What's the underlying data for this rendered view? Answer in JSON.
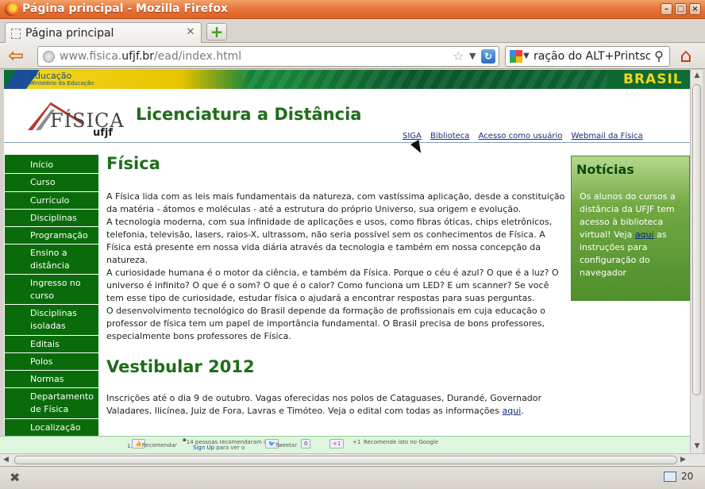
{
  "window": {
    "title": "Página principal - Mozilla Firefox"
  },
  "tab": {
    "label": "Página principal",
    "new_tab": "+"
  },
  "toolbar": {
    "url_prefix": "www.fisica.",
    "url_domain": "ufjf.br",
    "url_suffix": "/ead/index.html",
    "search_value": "ração do ALT+Printscr",
    "search_engine_icon": "google-icon"
  },
  "gov_bar": {
    "edu_label": "Educação",
    "ministry_label": "Ministério da Educação",
    "brasil_label": "BRASIL"
  },
  "header": {
    "logo_text": "FÍSICA",
    "logo_sub": "ufjf",
    "title": "Licenciatura a Distância",
    "links": [
      "SIGA",
      "Biblioteca",
      "Acesso como usuário",
      "Webmail da Física"
    ]
  },
  "sidebar": {
    "items": [
      "Início",
      "Curso",
      "Currículo",
      "Disciplinas",
      "Programação",
      "Ensino a distância",
      "Ingresso no curso",
      "Disciplinas isoladas",
      "Editais",
      "Polos",
      "Normas",
      "Departamento de Física",
      "Localização"
    ]
  },
  "main": {
    "section1_title": "Física",
    "section1_p1": "A Física lida com as leis mais fundamentais da natureza, com vastíssima aplicação, desde a constituição da matéria - átomos e moléculas - até a estrutura do próprio Universo, sua origem e evolução.",
    "section1_p2": "A tecnologia moderna, com sua infinidade de aplicações e usos, como fibras óticas, chips eletrônicos, telefonia, televisão, lasers, raios-X, ultrassom, não seria possível sem os conhecimentos de Física. A Física está presente em nossa vida diária através da tecnologia e também em nossa concepção da natureza.",
    "section1_p3": "A curiosidade humana é o motor da ciência, e também da Física. Porque o céu é azul? O que é a luz? O universo é infinito? O que é o som? O que é o calor? Como funciona um LED? E um scanner? Se você tem esse tipo de curiosidade, estudar física o ajudará a encontrar respostas para suas perguntas.",
    "section1_p4": "O desenvolvimento tecnológico do Brasil depende da formação de profissionais em cuja educação o professor de física tem um papel de importância fundamental. O Brasil precisa de bons professores, especialmente bons professores de Física.",
    "section2_title": "Vestibular 2012",
    "section2_text": "Inscrições até o dia 9 de outubro. Vagas oferecidas nos polos de Cataguases, Durandé, Governador Valadares, Ilicínea, Juiz de Fora, Lavras e Timóteo. Veja o edital com todas as informações",
    "section2_link": "aqui",
    "section2_end": "."
  },
  "news": {
    "title": "Notícias",
    "body_before": "Os alunos do cursos a distância da UFJF tem acesso à biblioteca virtual! Veja",
    "link": "aqui",
    "body_after": "as instruções para configuração do navegador"
  },
  "social": {
    "list_num": "1.",
    "recommend": "Recomendar",
    "fb_count": "14 pessoas recomendaram isso.",
    "fb_signup": "Sign Up",
    "fb_signup_tail": "para ver o",
    "tweet": "Tweetar",
    "tweet_count": "0",
    "plus_one": "+1",
    "plus_one_count": "+1",
    "google_recommend": "Recomende isto no Google"
  },
  "status": {
    "mail_count": "20"
  }
}
